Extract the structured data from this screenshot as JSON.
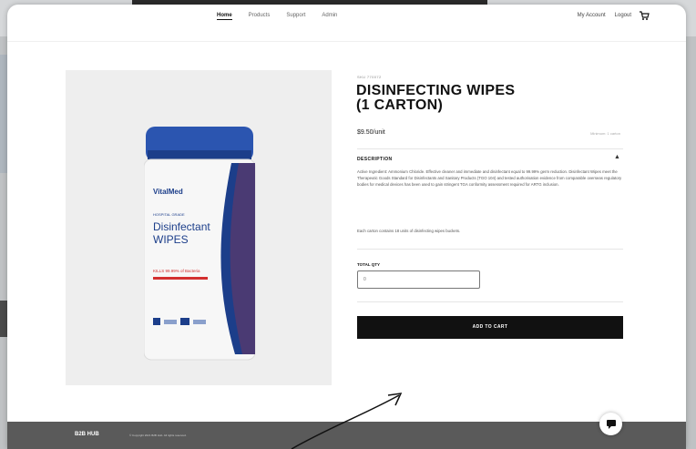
{
  "nav": {
    "links": [
      "Home",
      "Products",
      "Support",
      "Admin"
    ],
    "right": [
      "My Account",
      "Logout"
    ]
  },
  "product": {
    "sku": "SKU 770072",
    "title_line1": "DISINFECTING WIPES",
    "title_line2": "(1 CARTON)",
    "price": "$9.50/unit",
    "price_note": "Minimum: 1 carton",
    "description_header": "DESCRIPTION",
    "description": "Active Ingredient: Ammonium Chloride. Effective cleaner and immediate and disinfectant equal to 99.99% germ reduction. Disinfectant Wipes meet the Therapeutic Goods Standard for Disinfectants and Sanitary Products (TGO 104) and tested authorisation evidence from comparable overseas regulatory bodies for medical devices has been used to gain stringent TGA conformity assessment required for ARTG inclusion.",
    "description_extra": "Each carton contains 18 units of disinfecting wipes buckets.",
    "qty_label": "TOTAL QTY",
    "qty_placeholder": "0",
    "add_to_cart": "ADD TO CART",
    "canister_brand": "VitalMed",
    "canister_small": "HOSPITAL GRADE",
    "canister_name1": "Disinfectant",
    "canister_name2": "WIPES",
    "canister_claim": "KILLS 99.99% of Bacteria"
  },
  "footer": {
    "logo": "B2B HUB",
    "text": "© Copyright 2021 B2B Hub. All rights reserved."
  },
  "colors": {
    "accent": "#111111",
    "canister_lid": "#2b55b0",
    "canister_band": "#1c3e8a",
    "claim_red": "#d32f2f",
    "footer": "#5a5a5a"
  }
}
